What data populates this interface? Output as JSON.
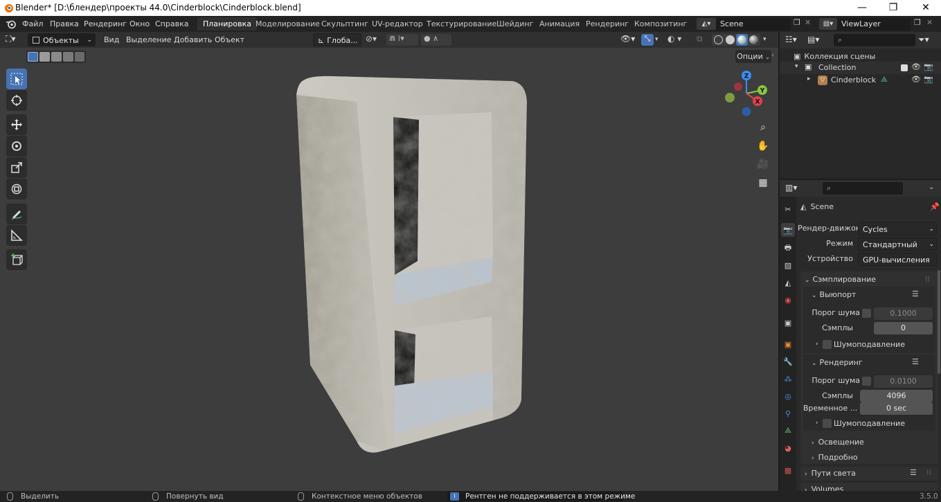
{
  "titlebar": {
    "title": "Blender* [D:\\блендер\\проекты 44.0\\Cinderblock\\Cinderblock.blend]",
    "minimize": "—",
    "maximize": "❐",
    "close": "✕"
  },
  "menu": [
    "Файл",
    "Правка",
    "Рендеринг",
    "Окно",
    "Справка"
  ],
  "workspaces": [
    "Планировка",
    "Моделирование",
    "Скульптинг",
    "UV-редактор",
    "Текстурирование",
    "Шейдинг",
    "Анимация",
    "Рендеринг",
    "Композитинг"
  ],
  "active_workspace": "Планировка",
  "scene_name": "Scene",
  "view_layer": "ViewLayer",
  "viewport_header": {
    "mode": "Объекты",
    "menus": [
      "Вид",
      "Выделение",
      "Добавить",
      "Объект"
    ],
    "transform_orientation": "Глоба...",
    "options_label": "Опции"
  },
  "gizmo": {
    "z": "Z",
    "y": "Y",
    "x": "X"
  },
  "outliner": {
    "scene_collection": "Коллекция сцены",
    "collection": "Collection",
    "object": "Cinderblock"
  },
  "properties": {
    "context": "Scene",
    "render_engine_label": "Рендер-движок",
    "render_engine": "Cycles",
    "mode_label": "Режим",
    "mode": "Стандартный",
    "device_label": "Устройство",
    "device": "GPU-вычисления",
    "sampling": "Сэмплирование",
    "viewport_section": "Выюпорт",
    "vp_noise_label": "Порог шума",
    "vp_noise": "0.1000",
    "vp_samples_label": "Сэмплы",
    "vp_samples": "0",
    "vp_denoise": "Шумоподавление",
    "render_section": "Рендеринг",
    "r_noise_label": "Порог шума",
    "r_noise": "0.0100",
    "r_samples_label": "Сэмплы",
    "r_samples": "4096",
    "r_time_label": "Временное ...",
    "r_time": "0 sec",
    "r_denoise": "Шумоподавление",
    "lighting": "Освещение",
    "advanced": "Подробно",
    "light_paths": "Пути света",
    "volumes": "Volumes"
  },
  "status": {
    "select": "Выделить",
    "rotate": "Повернуть вид",
    "context_menu": "Контекстное меню объектов",
    "message": "Рентген не поддерживается в этом режиме",
    "version": "3.5.0"
  },
  "colors": {
    "accent": "#4772b3",
    "x_axis": "#e0404f",
    "y_axis": "#8bc53f",
    "z_axis": "#3a8ef0",
    "viewport_bg": "#3d3d3d"
  }
}
